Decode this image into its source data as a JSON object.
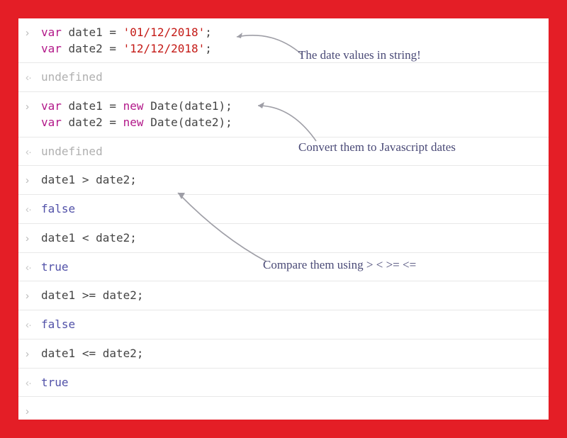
{
  "console": {
    "rows": [
      {
        "type": "in",
        "code": "var date1 = '01/12/2018';\nvar date2 = '12/12/2018';"
      },
      {
        "type": "out",
        "code": "undefined"
      },
      {
        "type": "in",
        "code": "var date1 = new Date(date1);\nvar date2 = new Date(date2);"
      },
      {
        "type": "out",
        "code": "undefined"
      },
      {
        "type": "in",
        "code": "date1 > date2;"
      },
      {
        "type": "out",
        "code": "false"
      },
      {
        "type": "in",
        "code": "date1 < date2;"
      },
      {
        "type": "out",
        "code": "true"
      },
      {
        "type": "in",
        "code": "date1 >= date2;"
      },
      {
        "type": "out",
        "code": "false"
      },
      {
        "type": "in",
        "code": "date1 <= date2;"
      },
      {
        "type": "out",
        "code": "true"
      },
      {
        "type": "in",
        "code": ""
      }
    ]
  },
  "annotations": {
    "a1": "The date values in string!",
    "a2": "Convert them to Javascript dates",
    "a3": "Compare them using > < >= <="
  }
}
